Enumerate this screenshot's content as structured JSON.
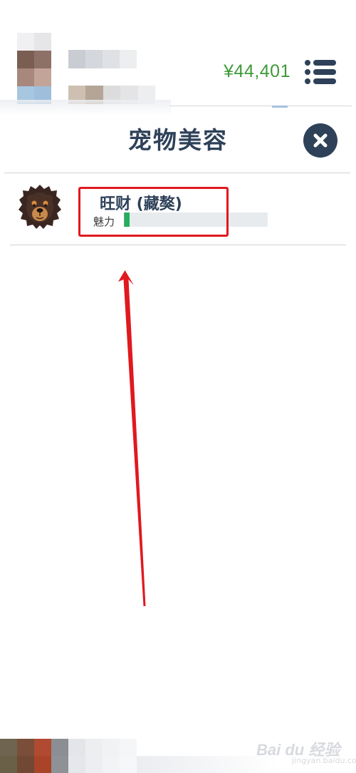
{
  "header": {
    "balance": "¥44,401",
    "avatar_blur_colors": [
      "#f0f0f2",
      "#e6e6e8",
      "#7a5e52",
      "#8e7166",
      "#a8887c",
      "#c3a498",
      "#a7c7e0",
      "#9ebfdc"
    ],
    "name_blur_colors": [
      "#c9ccd2",
      "#d4d7dc",
      "#dfe1e5",
      "#eceef0"
    ],
    "sub_blur_colors": [
      "#cdc0b2",
      "#b5a597",
      "#dcdcdc",
      "#e4e4e6",
      "#eceef0"
    ]
  },
  "modal": {
    "title": "宠物美容"
  },
  "pet": {
    "name": "旺财 (藏獒)",
    "charm_label": "魅力",
    "charm_fraction": 0.04
  },
  "footer": {
    "blur_colors": [
      "#6e6450",
      "#7a4e38",
      "#b04a30",
      "#8b8e92",
      "#e4e5e8",
      "#eceef0",
      "#f1f2f4",
      "#f5f6f7",
      "#6a6048",
      "#704834",
      "#a94428",
      "#8e9196",
      "#e6e7ea",
      "#edeef1",
      "#f2f3f5",
      "#f6f7f8"
    ]
  },
  "watermark": {
    "main": "Bai du 经验",
    "sub": "jingyan.baidu.com"
  },
  "colors": {
    "accent_dark": "#2e4159",
    "balance_green": "#3f9a3a",
    "charm_green": "#1fb25a",
    "annotation_red": "#e0191e"
  },
  "icons": {
    "menu": "menu-list-icon",
    "close": "close-icon",
    "pet_avatar": "mastiff-face-icon",
    "annotation": "red-arrow-annotation"
  }
}
